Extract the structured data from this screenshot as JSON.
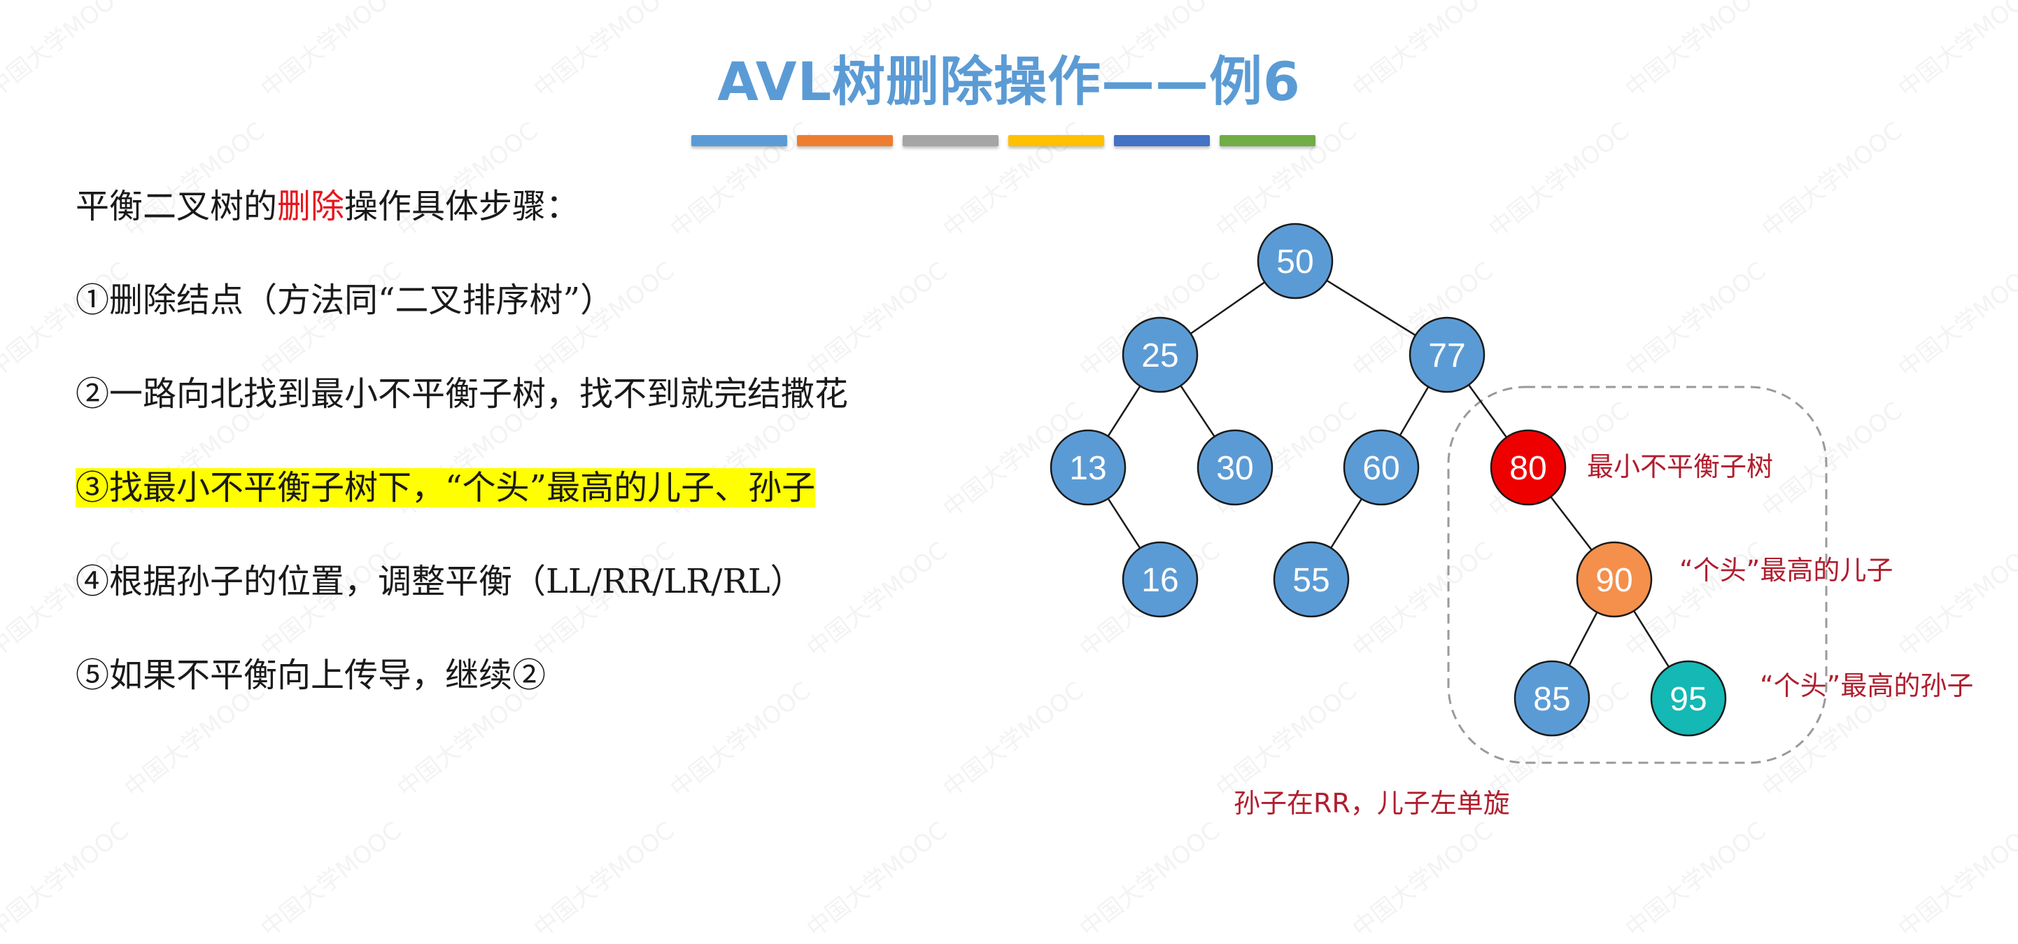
{
  "slide": {
    "title": "AVL树删除操作——例6",
    "color_bar": [
      "#5b9bd5",
      "#ed7d31",
      "#a5a5a5",
      "#ffc000",
      "#4472c4",
      "#70ad47"
    ],
    "watermark_text": "中国大学MOOC"
  },
  "steps": {
    "intro_pre": "平衡二叉树的",
    "intro_red": "删除",
    "intro_post": "操作具体步骤：",
    "step1": "①删除结点（方法同“二叉排序树”）",
    "step2": "②一路向北找到最小不平衡子树，找不到就完结撒花",
    "step3": "③找最小不平衡子树下，“个头”最高的儿子、孙子",
    "step4": "④根据孙子的位置，调整平衡（LL/RR/LR/RL）",
    "step5": "⑤如果不平衡向上传导，继续②"
  },
  "tree": {
    "colors": {
      "default": "#5b9bd5",
      "unbalanced": "#ee0000",
      "son": "#f4904c",
      "grandson": "#14b8b4"
    },
    "nodes": [
      {
        "id": "n50",
        "label": "50",
        "role": "default"
      },
      {
        "id": "n25",
        "label": "25",
        "role": "default"
      },
      {
        "id": "n77",
        "label": "77",
        "role": "default"
      },
      {
        "id": "n13",
        "label": "13",
        "role": "default"
      },
      {
        "id": "n30",
        "label": "30",
        "role": "default"
      },
      {
        "id": "n60",
        "label": "60",
        "role": "default"
      },
      {
        "id": "n80",
        "label": "80",
        "role": "unbalanced"
      },
      {
        "id": "n16",
        "label": "16",
        "role": "default"
      },
      {
        "id": "n55",
        "label": "55",
        "role": "default"
      },
      {
        "id": "n90",
        "label": "90",
        "role": "son"
      },
      {
        "id": "n85",
        "label": "85",
        "role": "default"
      },
      {
        "id": "n95",
        "label": "95",
        "role": "grandson"
      }
    ],
    "edges": [
      [
        "n50",
        "n25"
      ],
      [
        "n50",
        "n77"
      ],
      [
        "n25",
        "n13"
      ],
      [
        "n25",
        "n30"
      ],
      [
        "n77",
        "n60"
      ],
      [
        "n77",
        "n80"
      ],
      [
        "n13",
        "n16"
      ],
      [
        "n60",
        "n55"
      ],
      [
        "n80",
        "n90"
      ],
      [
        "n90",
        "n85"
      ],
      [
        "n90",
        "n95"
      ]
    ]
  },
  "annotations": {
    "unbalanced": "最小不平衡子树",
    "son": "“个头”最高的儿子",
    "grandson": "“个头”最高的孙子",
    "rotation": "孙子在RR，儿子左单旋"
  }
}
